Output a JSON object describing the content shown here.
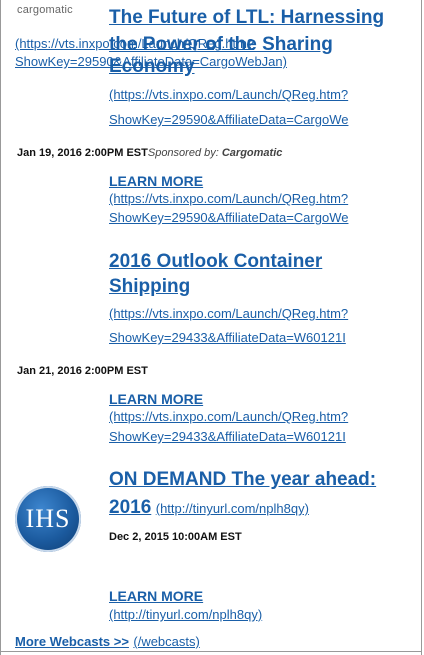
{
  "webcasts": [
    {
      "logo_text": "cargomatic",
      "title_lines": [
        "The Future of LTL: Harnessing",
        "the Power of the Sharing",
        "Economy"
      ],
      "title_url_lines": [
        "(https://vts.inxpo.com/Launch/QReg.htm?",
        "ShowKey=29590&AffiliateData=CargoWebJan)"
      ],
      "url_lines": [
        "(https://vts.inxpo.com/Launch/QReg.htm?",
        "ShowKey=29590&AffiliateData=CargoWe"
      ],
      "date": "Jan 19, 2016 2:00PM EST",
      "sponsored_label": "Sponsored by:",
      "sponsor": "Cargomatic",
      "learn_more": "LEARN MORE",
      "learn_url_lines": [
        "(https://vts.inxpo.com/Launch/QReg.htm?",
        "ShowKey=29590&AffiliateData=CargoWe"
      ]
    },
    {
      "title_lines": [
        "2016 Outlook Container",
        "Shipping"
      ],
      "url_lines": [
        "(https://vts.inxpo.com/Launch/QReg.htm?",
        "ShowKey=29433&AffiliateData=W60121I"
      ],
      "date": "Jan 21, 2016 2:00PM EST",
      "learn_more": "LEARN MORE",
      "learn_url_lines": [
        "(https://vts.inxpo.com/Launch/QReg.htm?",
        "ShowKey=29433&AffiliateData=W60121I"
      ]
    },
    {
      "logo_text": "IHS",
      "title_lines": [
        "ON DEMAND The year ahead:",
        "2016"
      ],
      "title_url": "(http://tinyurl.com/nplh8qy)",
      "date": "Dec 2, 2015 10:00AM EST",
      "learn_more": "LEARN MORE",
      "learn_url": "(http://tinyurl.com/nplh8qy)"
    }
  ],
  "footer": {
    "more_label": "More Webcasts >>",
    "more_url": "(/webcasts)"
  }
}
